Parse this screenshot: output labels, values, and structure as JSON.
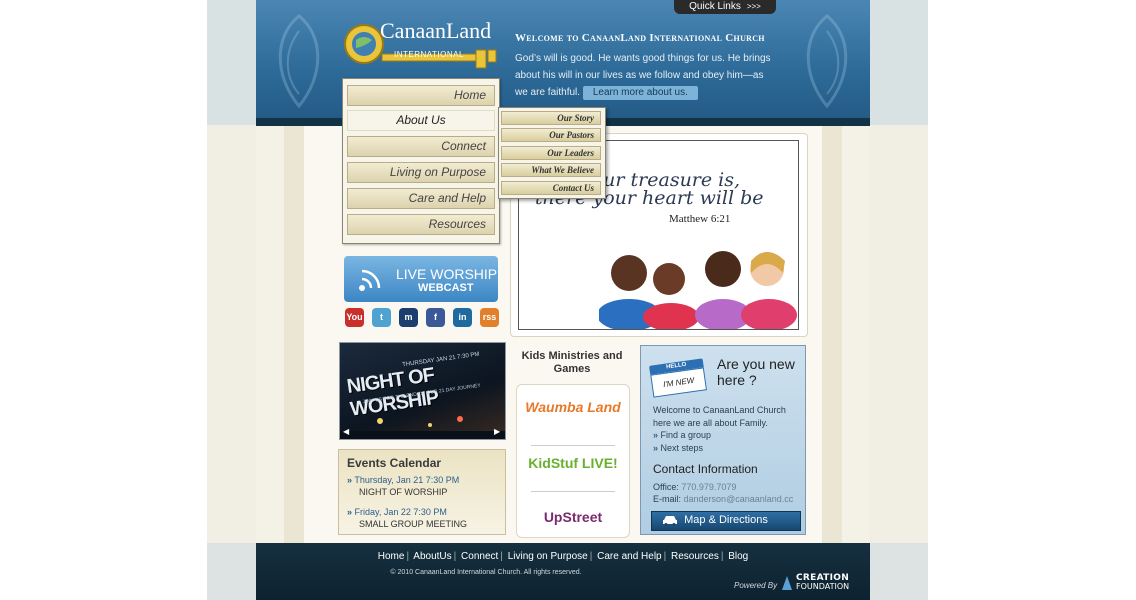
{
  "quick_links": {
    "label": "Quick Links",
    "arrows": ">>>"
  },
  "logo": {
    "name": "CanaanLand",
    "sub": "INTERNATIONAL"
  },
  "welcome": {
    "title": "Welcome to CanaanLand International Church",
    "text": "God’s will is good. He wants good things for us. He brings about his will in our lives as we follow and obey him—as we are faithful.",
    "button": "Learn more about us."
  },
  "nav": {
    "items": [
      {
        "label": "Home"
      },
      {
        "label": "About Us"
      },
      {
        "label": "Connect"
      },
      {
        "label": "Living on Purpose"
      },
      {
        "label": "Care and Help"
      },
      {
        "label": "Resources"
      }
    ],
    "submenu": [
      {
        "label": "Our Story"
      },
      {
        "label": "Our Pastors"
      },
      {
        "label": "Our Leaders"
      },
      {
        "label": "What We Believe"
      },
      {
        "label": "Contact Us"
      }
    ]
  },
  "banner": {
    "verse_line1": "your treasure is,",
    "verse_line2": "there your heart will be",
    "reference": "Matthew 6:21"
  },
  "live": {
    "line1": "LIVE WORSHIP",
    "line2": "WEBCAST"
  },
  "social": [
    {
      "icon": "youtube-icon",
      "text": "You",
      "color": "#c9302c"
    },
    {
      "icon": "twitter-icon",
      "text": "t",
      "color": "#4fa3d1"
    },
    {
      "icon": "myspace-icon",
      "text": "m",
      "color": "#1b3e6f"
    },
    {
      "icon": "facebook-icon",
      "text": "f",
      "color": "#3b5998"
    },
    {
      "icon": "linkedin-icon",
      "text": "in",
      "color": "#1f6ba0"
    },
    {
      "icon": "rss-icon",
      "text": "rss",
      "color": "#e0802a"
    }
  ],
  "promo": {
    "date": "THURSDAY JAN 21 7:30 PM",
    "title": "NIGHT OF WORSHIP",
    "sub": "JOIN US FOR THE END OF OUR 21 DAY JOURNEY"
  },
  "events": {
    "title": "Events Calendar",
    "items": [
      {
        "date": "Thursday, Jan 21 7:30 PM",
        "name": "NIGHT OF WORSHIP"
      },
      {
        "date": "Friday, Jan 22 7:30 PM",
        "name": "SMALL GROUP MEETING"
      }
    ]
  },
  "kids": {
    "title": "Kids Ministries and Games",
    "logos": [
      "Waumba Land",
      "KidStuf LIVE!",
      "UpStreet"
    ]
  },
  "newhere": {
    "tag_top": "HELLO",
    "tag_bottom": "I'M NEW",
    "title": "Are you new here ?",
    "text": "Welcome to CanaanLand Church here we are all about Family.",
    "link1": "Find a group",
    "link2": "Next steps",
    "contact_title": "Contact Information",
    "office_label": "Office:",
    "office_value": "770.979.7079",
    "email_label": "E-mail:",
    "email_value": "danderson@canaanland.cc",
    "map_button": "Map & Directions"
  },
  "footer": {
    "links": [
      "Home",
      "AboutUs",
      "Connect",
      "Living on Purpose",
      "Care and Help",
      "Resources",
      "Blog"
    ],
    "copyright": "© 2010 CanaanLand International Church. All rights reserved.",
    "powered": "Powered By",
    "cf_line1": "CREATION",
    "cf_line2": "FOUNDATION"
  }
}
